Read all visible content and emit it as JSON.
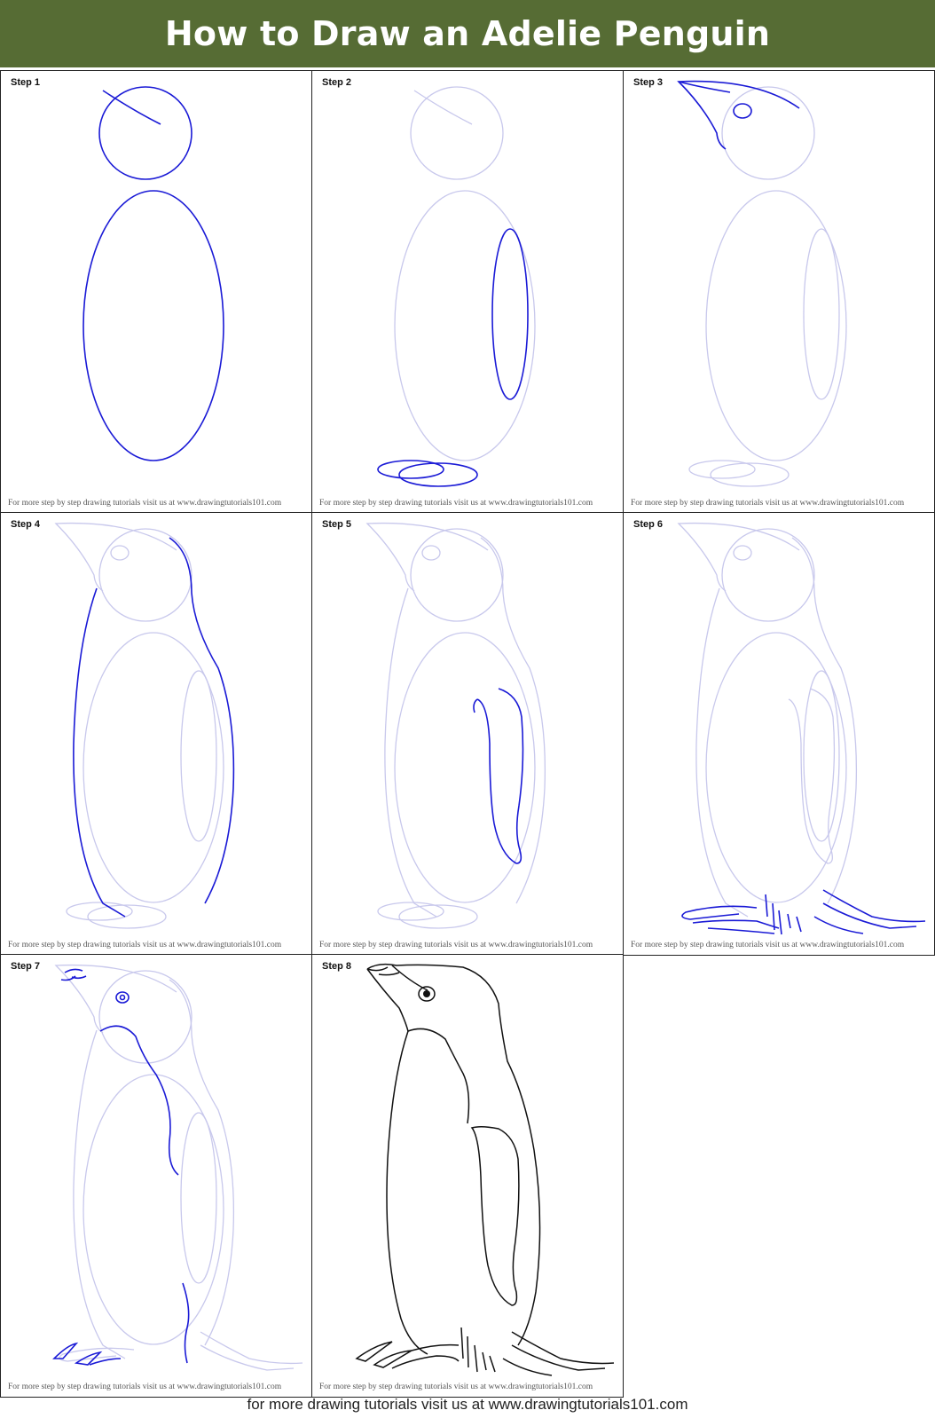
{
  "header": {
    "title": "How to Draw an Adelie Penguin",
    "bg_color": "#566c34"
  },
  "credit_text": "For more step by step drawing tutorials visit us at www.drawingtutorials101.com",
  "steps": [
    {
      "label": "Step 1"
    },
    {
      "label": "Step 2"
    },
    {
      "label": "Step 3"
    },
    {
      "label": "Step 4"
    },
    {
      "label": "Step 5"
    },
    {
      "label": "Step 6"
    },
    {
      "label": "Step 7"
    },
    {
      "label": "Step 8"
    }
  ],
  "footer": {
    "text": "for more drawing tutorials visit us at www.drawingtutorials101.com"
  },
  "colors": {
    "guide": "#c8c8ec",
    "new_line": "#1a1ad6",
    "final_line": "#111111"
  }
}
